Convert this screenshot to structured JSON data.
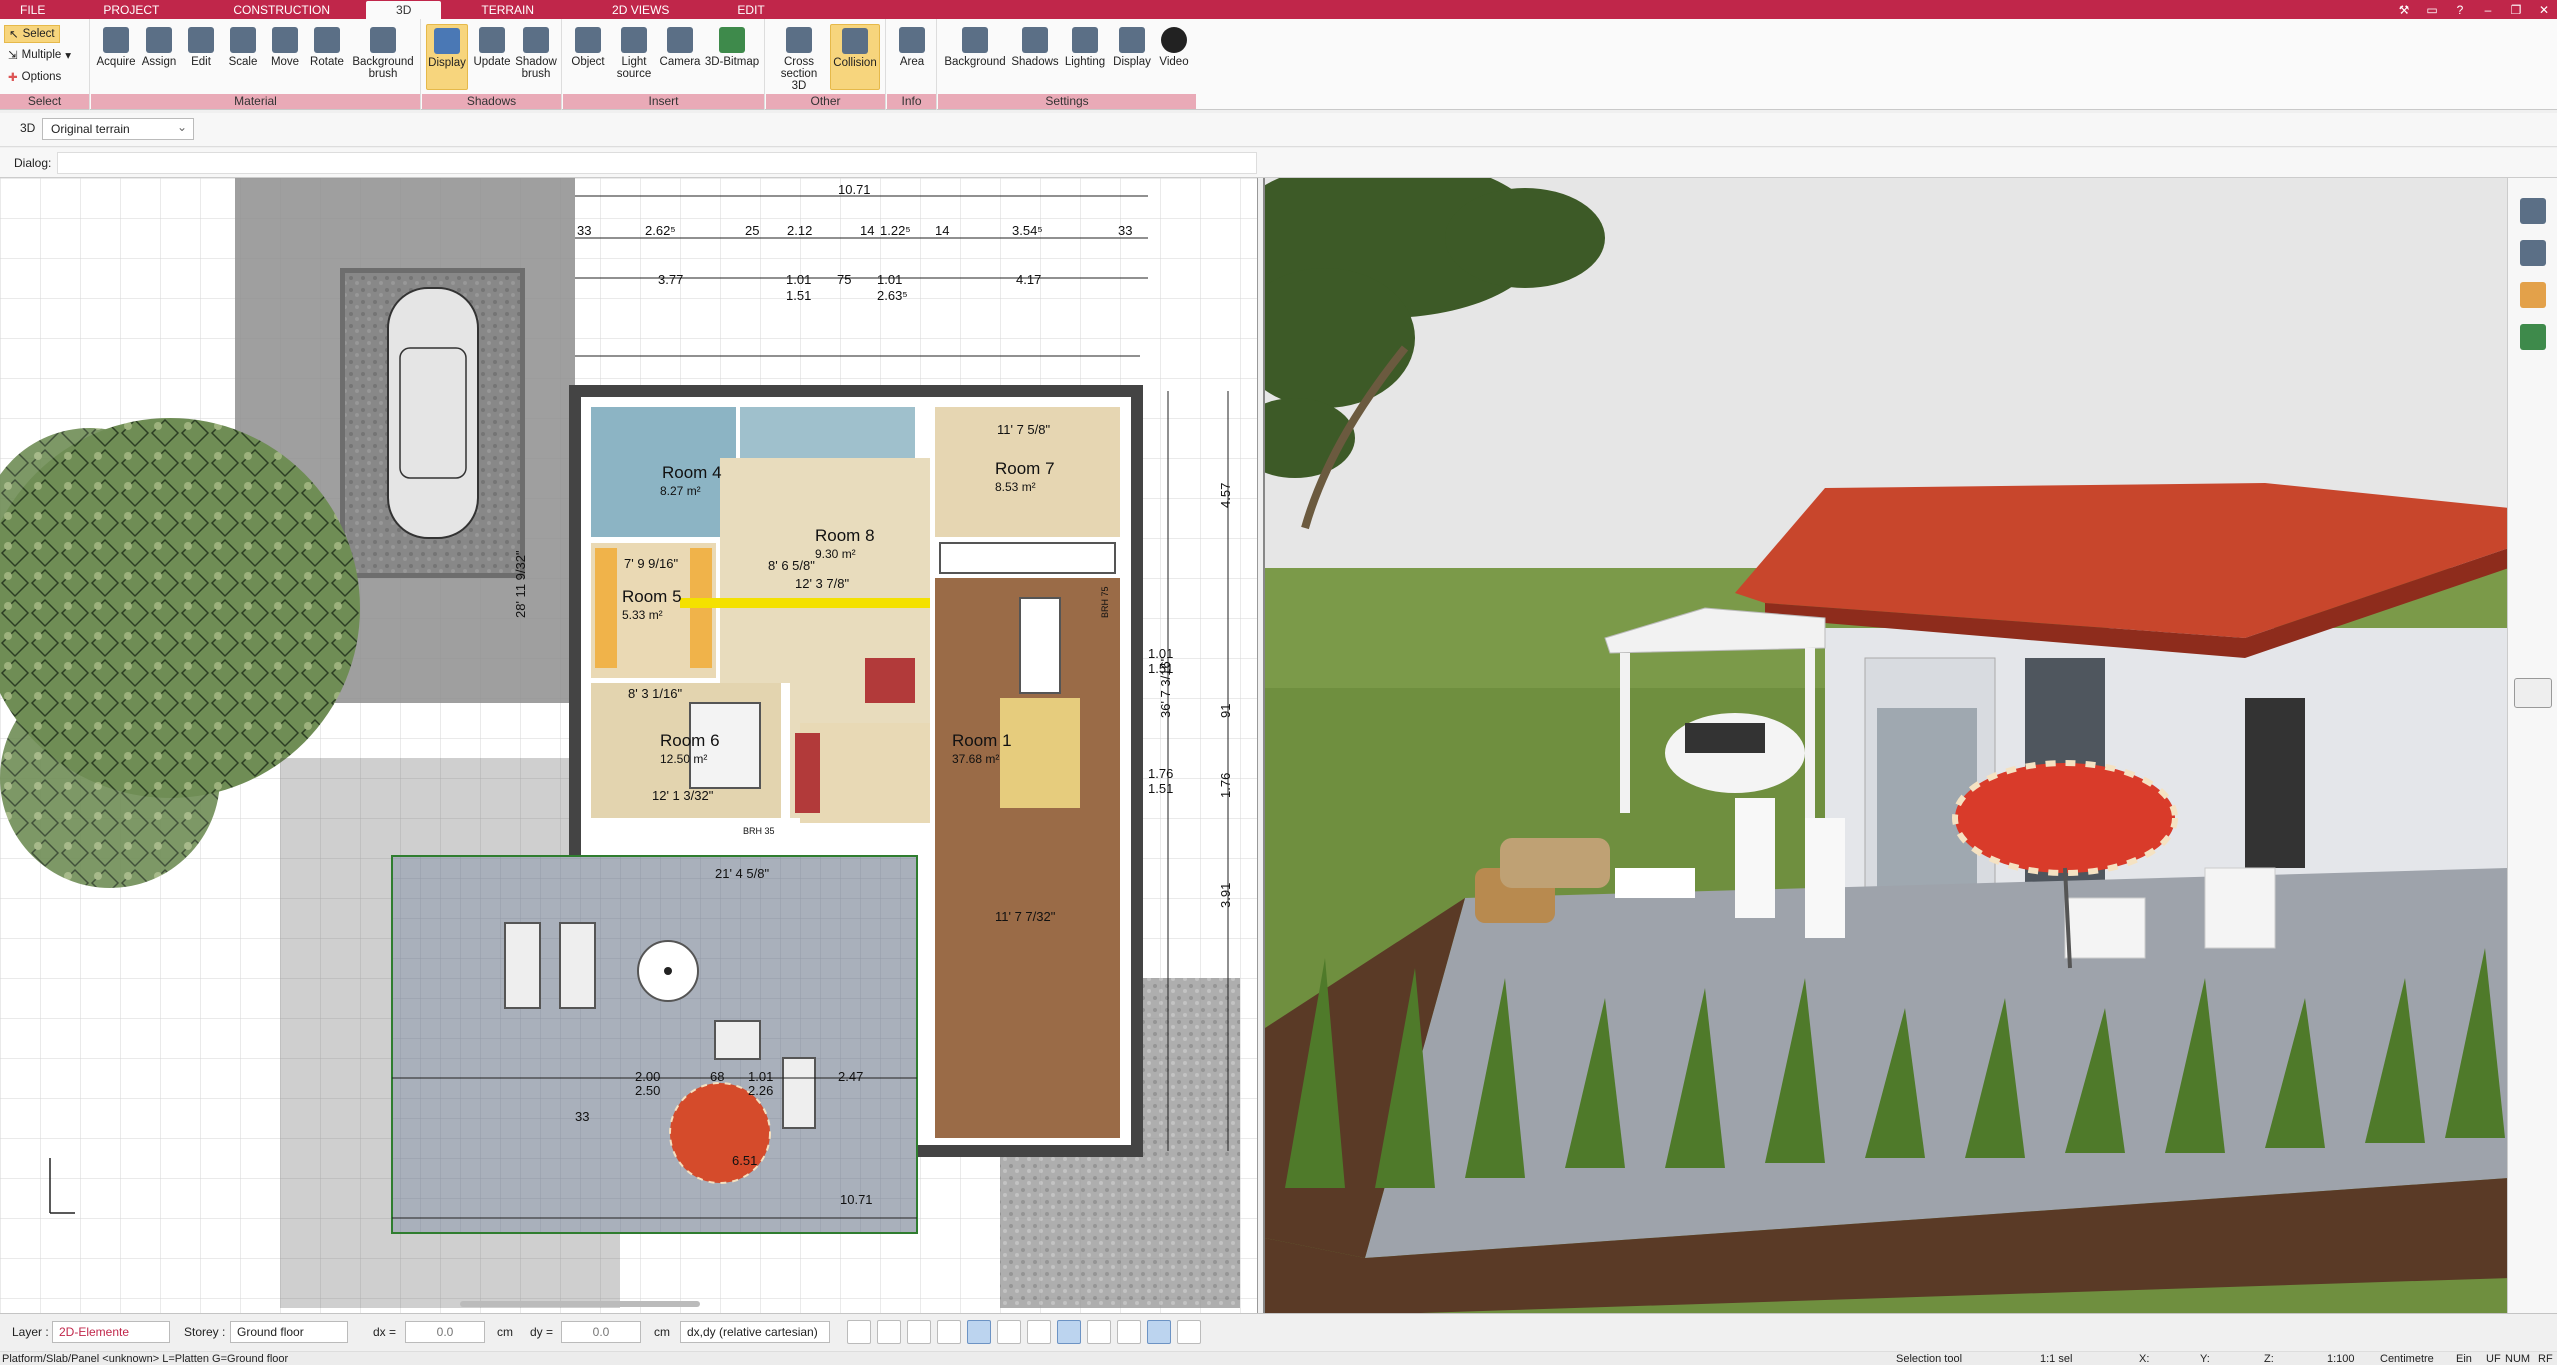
{
  "menu": {
    "tabs": [
      "FILE",
      "PROJECT",
      "CONSTRUCTION",
      "3D",
      "TERRAIN",
      "2D VIEWS",
      "EDIT"
    ],
    "active": "3D"
  },
  "ribbon": {
    "select_group": {
      "select": "Select",
      "multiple": "Multiple",
      "options": "Options",
      "label": "Select"
    },
    "material": {
      "label": "Material",
      "buttons": [
        "Acquire",
        "Assign",
        "Edit",
        "Scale",
        "Move",
        "Rotate",
        "Background brush"
      ]
    },
    "shadows": {
      "label": "Shadows",
      "buttons": [
        "Display",
        "Update",
        "Shadow brush"
      ]
    },
    "insert": {
      "label": "Insert",
      "buttons": [
        "Object",
        "Light source",
        "Camera",
        "3D-Bitmap"
      ]
    },
    "other": {
      "label": "Other",
      "buttons": [
        "Cross section 3D",
        "Collision"
      ]
    },
    "info": {
      "label": "Info",
      "buttons": [
        "Area"
      ]
    },
    "settings": {
      "label": "Settings",
      "buttons": [
        "Background",
        "Shadows",
        "Lighting",
        "Display",
        "Video"
      ]
    }
  },
  "optionbar": {
    "mode": "3D",
    "terrain": "Original terrain"
  },
  "dialog": {
    "label": "Dialog:"
  },
  "plan": {
    "rooms": [
      {
        "name": "Room 4",
        "area": "8.27 m²"
      },
      {
        "name": "Room 7",
        "area": "8.53 m²"
      },
      {
        "name": "Room 8",
        "area": "9.30 m²"
      },
      {
        "name": "Room 5",
        "area": "5.33 m²"
      },
      {
        "name": "Room 6",
        "area": "12.50 m²"
      },
      {
        "name": "Room 1",
        "area": "37.68 m²"
      }
    ],
    "dims_top": [
      "10.71",
      "2.62⁵",
      "25",
      "2.12",
      "14",
      "1.22⁵",
      "14",
      "3.54⁵",
      "33",
      "33",
      "3.77",
      "1.01",
      "75",
      "1.01",
      "4.17",
      "1.51",
      "2.63⁵"
    ],
    "dims_right": [
      "4.57",
      "1.01",
      "1.51",
      "91",
      "1.76",
      "1.51",
      "1.76",
      "3.91",
      "36' 7 3/16\""
    ],
    "dims_terrace": [
      "2.00",
      "2.50",
      "68",
      "1.01",
      "2.26",
      "2.47",
      "33",
      "10.71",
      "21' 4 5/8\"",
      "6.51"
    ],
    "notes": [
      "28' 11 9/32\"",
      "11' 7 5/8\"",
      "12' 3 7/8\"",
      "8' 6 5/8\"",
      "11' 7 7/32\"",
      "12' 1 3/32\"",
      "8' 3 1/16\"",
      "7' 9 9/16\"",
      "BRH 75",
      "BRH 35"
    ]
  },
  "statusbar": {
    "layer_label": "Layer :",
    "layer_value": "2D-Elemente",
    "storey_label": "Storey :",
    "storey_value": "Ground floor",
    "dx_label": "dx =",
    "dx_value": "0.0",
    "dy_label": "dy =",
    "dy_value": "0.0",
    "unit": "cm",
    "coord_mode": "dx,dy (relative cartesian)"
  },
  "infobar": {
    "status": "Platform/Slab/Panel <unknown> L=Platten G=Ground floor",
    "tool": "Selection tool",
    "sel": "1:1 sel",
    "x": "X:",
    "y": "Y:",
    "z": "Z:",
    "scale": "1:100",
    "units": "Centimetre",
    "ein": "Ein",
    "uf": "UF",
    "num": "NUM",
    "rf": "RF"
  },
  "colors": {
    "menubar": "#c0264a",
    "group_label": "#e9aab7",
    "active_btn": "#f7d57d",
    "roof": "#c8462c",
    "grass": "#6f8f3f"
  }
}
